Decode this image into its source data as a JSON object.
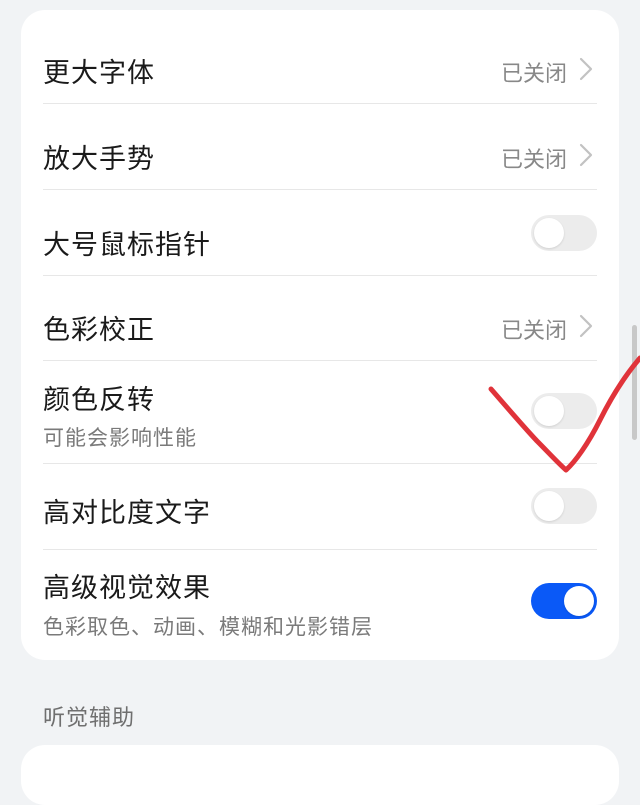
{
  "settings": {
    "items": [
      {
        "title": "更大字体",
        "status": "已关闭",
        "control": "chevron"
      },
      {
        "title": "放大手势",
        "status": "已关闭",
        "control": "chevron"
      },
      {
        "title": "大号鼠标指针",
        "control": "toggle",
        "enabled": false
      },
      {
        "title": "色彩校正",
        "status": "已关闭",
        "control": "chevron"
      },
      {
        "title": "颜色反转",
        "subtitle": "可能会影响性能",
        "control": "toggle",
        "enabled": false
      },
      {
        "title": "高对比度文字",
        "control": "toggle",
        "enabled": false
      },
      {
        "title": "高级视觉效果",
        "subtitle": "色彩取色、动画、模糊和光影错层",
        "control": "toggle",
        "enabled": true
      }
    ]
  },
  "section": {
    "hearing_header": "听觉辅助"
  },
  "icons": {
    "chevron": "chevron-right-icon"
  },
  "colors": {
    "background": "#f1f3f5",
    "card": "#ffffff",
    "toggle_on": "#0a59f7",
    "toggle_off": "#ececec",
    "annotation_stroke": "#e0333a"
  }
}
